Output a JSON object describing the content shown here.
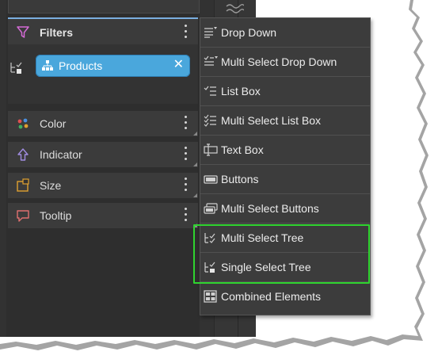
{
  "left_panel": {
    "filters": {
      "label": "Filters",
      "chip": {
        "label": "Products",
        "close": "✕"
      }
    },
    "rows": [
      {
        "label": "Color",
        "icon": "color-dots-icon"
      },
      {
        "label": "Indicator",
        "icon": "up-arrow-icon"
      },
      {
        "label": "Size",
        "icon": "size-icon"
      },
      {
        "label": "Tooltip",
        "icon": "tooltip-icon"
      }
    ]
  },
  "dropdown_menu": {
    "items": [
      {
        "label": "Drop Down",
        "icon": "dropdown-list-icon"
      },
      {
        "label": "Multi Select Drop Down",
        "icon": "multi-dropdown-icon"
      },
      {
        "label": "List Box",
        "icon": "listbox-icon"
      },
      {
        "label": "Multi Select List Box",
        "icon": "multi-listbox-icon"
      },
      {
        "label": "Text Box",
        "icon": "textbox-icon"
      },
      {
        "label": "Buttons",
        "icon": "button-icon"
      },
      {
        "label": "Multi Select Buttons",
        "icon": "multi-buttons-icon"
      },
      {
        "label": "Multi Select Tree",
        "icon": "multi-tree-icon"
      },
      {
        "label": "Single Select Tree",
        "icon": "single-tree-icon"
      },
      {
        "label": "Combined Elements",
        "icon": "grid-icon"
      }
    ]
  },
  "colors": {
    "panel_bg": "#323232",
    "chip_bg": "#4aa7dc",
    "filter_icon": "#d46bd6",
    "highlight_box": "#2fd42f",
    "indicator_icon": "#a08ce0",
    "size_icon": "#e0a030",
    "tooltip_icon": "#e07070"
  }
}
